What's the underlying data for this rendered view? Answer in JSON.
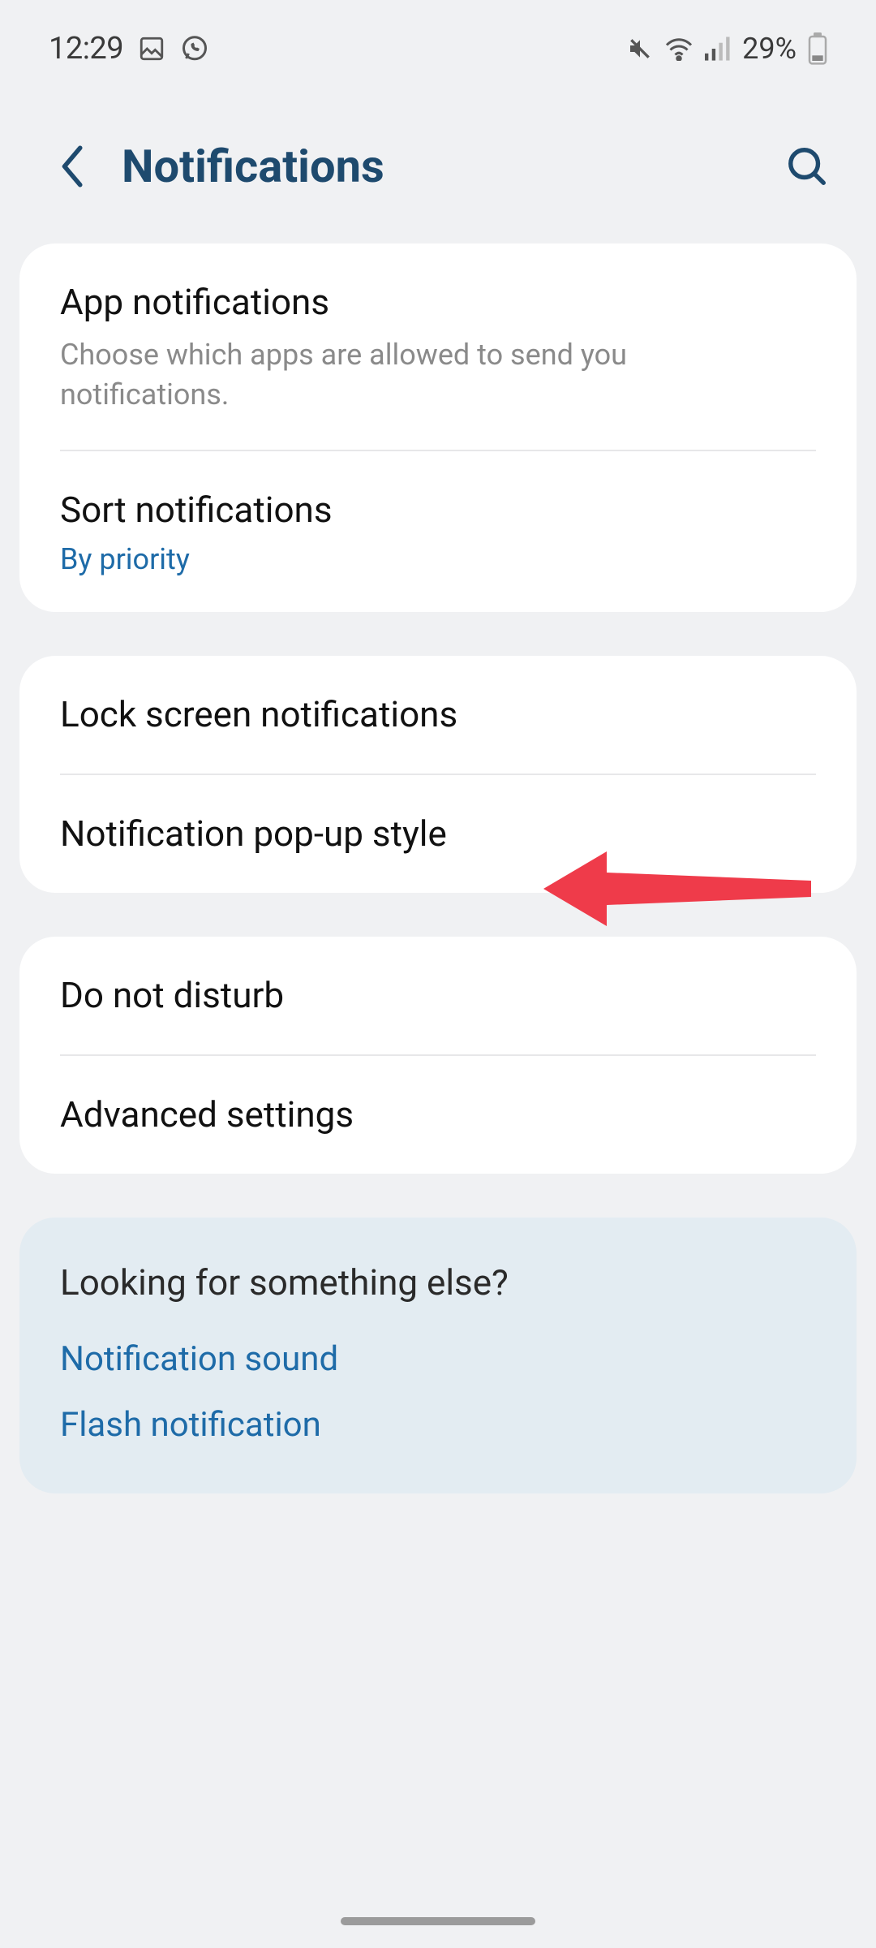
{
  "status": {
    "time": "12:29",
    "battery_pct": "29%"
  },
  "header": {
    "title": "Notifications"
  },
  "groups": [
    {
      "items": [
        {
          "title": "App notifications",
          "subtitle": "Choose which apps are allowed to send you notifications."
        },
        {
          "title": "Sort notifications",
          "value": "By priority"
        }
      ]
    },
    {
      "items": [
        {
          "title": "Lock screen notifications"
        },
        {
          "title": "Notification pop-up style"
        }
      ]
    },
    {
      "items": [
        {
          "title": "Do not disturb"
        },
        {
          "title": "Advanced settings"
        }
      ]
    }
  ],
  "lookfor": {
    "title": "Looking for something else?",
    "links": [
      "Notification sound",
      "Flash notification"
    ]
  }
}
